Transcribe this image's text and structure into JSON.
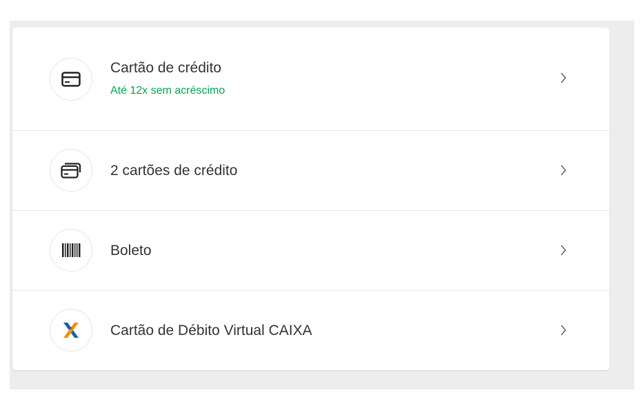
{
  "payment_methods": [
    {
      "title": "Cartão de crédito",
      "subtitle": "Até 12x sem acréscimo",
      "icon": "credit-card-icon"
    },
    {
      "title": "2 cartões de crédito",
      "icon": "two-credit-cards-icon"
    },
    {
      "title": "Boleto",
      "icon": "barcode-icon"
    },
    {
      "title": "Cartão de Débito Virtual CAIXA",
      "icon": "caixa-logo-icon"
    }
  ],
  "colors": {
    "accent_green": "#00a650",
    "text_primary": "#333333",
    "caixa_blue": "#1c5fa8",
    "caixa_orange": "#f39200",
    "chevron": "#666666",
    "backdrop": "#ededed"
  }
}
